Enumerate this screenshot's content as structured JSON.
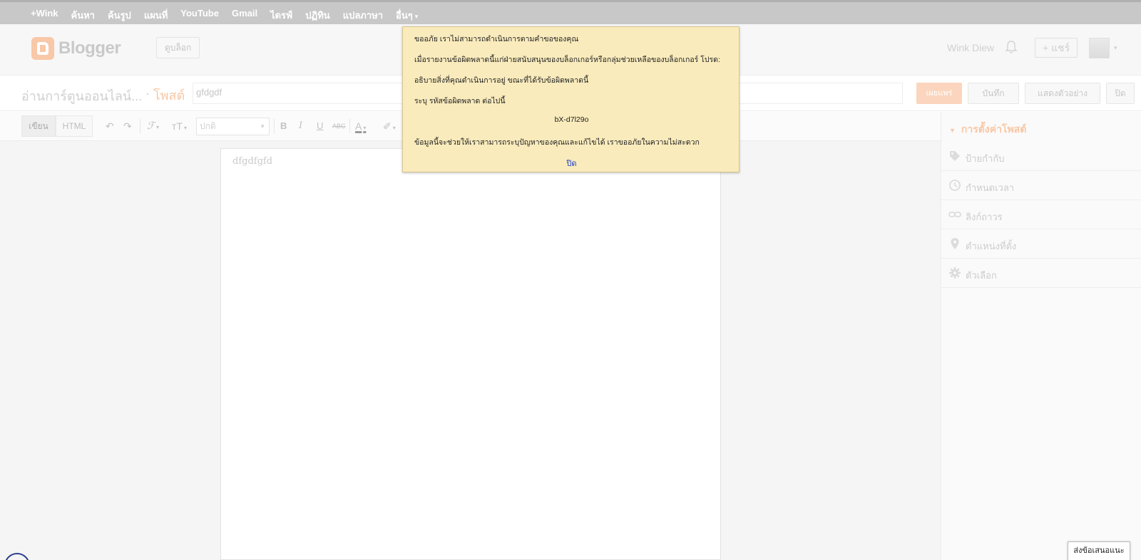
{
  "gbar": {
    "links": [
      "+Wink",
      "ค้นหา",
      "ค้นรูป",
      "แผนที่",
      "YouTube",
      "Gmail",
      "ไดรฟ์",
      "ปฏิทิน",
      "แปลภาษา"
    ],
    "more_label": "อื่นๆ"
  },
  "header": {
    "logo_text": "Blogger",
    "view_blog_label": "ดูบล็อก",
    "username": "Wink Diew",
    "share_label": "+ แชร์"
  },
  "titlerow": {
    "blog_name": "อ่านการ์ตูนออนไลน์...",
    "separator": "·",
    "post_word": "โพสต์",
    "post_title_value": "gfdgdf",
    "publish_label": "เผยแพร่",
    "save_label": "บันทึก",
    "preview_label": "แสดงตัวอย่าง",
    "close_label": "ปิด"
  },
  "toolbar": {
    "compose_label": "เขียน",
    "html_label": "HTML",
    "font_size_value": "ปกติ"
  },
  "editor": {
    "body_text": "dfgdfgfd"
  },
  "sidebar": {
    "heading": "การตั้งค่าโพสต์",
    "items": [
      {
        "label": "ป้ายกำกับ",
        "icon": "tag-icon"
      },
      {
        "label": "กำหนดเวลา",
        "icon": "clock-icon"
      },
      {
        "label": "ลิงก์ถาวร",
        "icon": "link-icon"
      },
      {
        "label": "ตำแหน่งที่ตั้ง",
        "icon": "location-pin-icon"
      },
      {
        "label": "ตัวเลือก",
        "icon": "gear-icon"
      }
    ]
  },
  "dialog": {
    "line1": "ขออภัย เราไม่สามารถดำเนินการตามคำขอของคุณ",
    "line2": "เมื่อรายงานข้อผิดพลาดนี้แก่ฝ่ายสนับสนุนของบล็อกเกอร์หรือกลุ่มช่วยเหลือของบล็อกเกอร์ โปรด:",
    "line3": "อธิบายสิ่งที่คุณดำเนินการอยู่ ขณะที่ได้รับข้อผิดพลาดนี้",
    "line4": "ระบุ รหัสข้อผิดพลาด ต่อไปนี้",
    "error_code": "bX-d7l29o",
    "line5": "ข้อมูลนี้จะช่วยให้เราสามารถระบุปัญหาของคุณและแก้ไขได้ เราขออภัยในความไม่สะดวก",
    "close_label": "ปิด"
  },
  "feedback_label": "ส่งข้อเสนอแนะ",
  "colors": {
    "accent": "#f57d00",
    "dialog_bg": "#f9ebbc",
    "link": "#1a3cc9"
  }
}
